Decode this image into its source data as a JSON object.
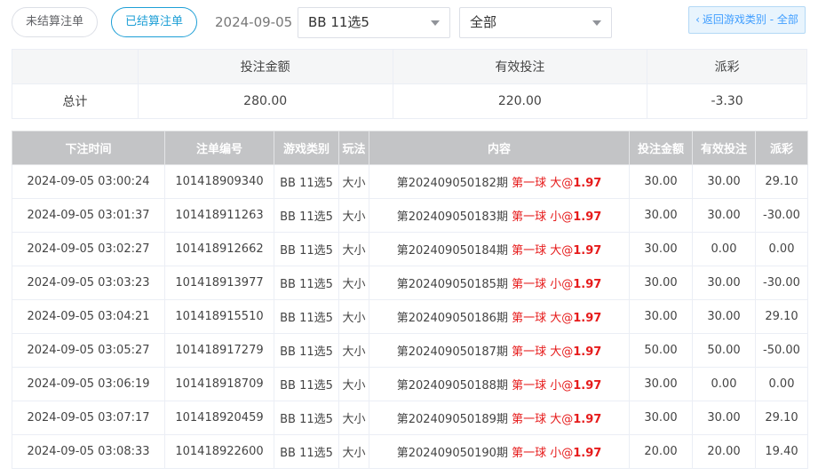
{
  "toolbar": {
    "unsettled_label": "未结算注单",
    "settled_label": "已结算注单",
    "date": "2024-09-05",
    "game_select": "BB 11选5",
    "type_select": "全部",
    "back_label": "返回游戏类别 - 全部"
  },
  "summary": {
    "headers": [
      "投注金额",
      "有效投注",
      "派彩"
    ],
    "row_label": "总计",
    "bet_amount": "280.00",
    "valid_bet": "220.00",
    "payout": "-3.30"
  },
  "detail": {
    "headers": [
      "下注时间",
      "注单编号",
      "游戏类别",
      "玩法",
      "内容",
      "投注金额",
      "有效投注",
      "派彩"
    ],
    "rows": [
      {
        "time": "2024-09-05 03:00:24",
        "id": "101418909340",
        "game": "BB 11选5",
        "play": "大小",
        "period": "第202409050182期",
        "pick": "第一球 大",
        "odds": "1.97",
        "bet": "30.00",
        "valid": "30.00",
        "payout": "29.10",
        "negative": false
      },
      {
        "time": "2024-09-05 03:01:37",
        "id": "101418911263",
        "game": "BB 11选5",
        "play": "大小",
        "period": "第202409050183期",
        "pick": "第一球 小",
        "odds": "1.97",
        "bet": "30.00",
        "valid": "30.00",
        "payout": "-30.00",
        "negative": true
      },
      {
        "time": "2024-09-05 03:02:27",
        "id": "101418912662",
        "game": "BB 11选5",
        "play": "大小",
        "period": "第202409050184期",
        "pick": "第一球 大",
        "odds": "1.97",
        "bet": "30.00",
        "valid": "0.00",
        "payout": "0.00",
        "negative": false
      },
      {
        "time": "2024-09-05 03:03:23",
        "id": "101418913977",
        "game": "BB 11选5",
        "play": "大小",
        "period": "第202409050185期",
        "pick": "第一球 小",
        "odds": "1.97",
        "bet": "30.00",
        "valid": "30.00",
        "payout": "-30.00",
        "negative": true
      },
      {
        "time": "2024-09-05 03:04:21",
        "id": "101418915510",
        "game": "BB 11选5",
        "play": "大小",
        "period": "第202409050186期",
        "pick": "第一球 大",
        "odds": "1.97",
        "bet": "30.00",
        "valid": "30.00",
        "payout": "29.10",
        "negative": false
      },
      {
        "time": "2024-09-05 03:05:27",
        "id": "101418917279",
        "game": "BB 11选5",
        "play": "大小",
        "period": "第202409050187期",
        "pick": "第一球 大",
        "odds": "1.97",
        "bet": "50.00",
        "valid": "50.00",
        "payout": "-50.00",
        "negative": true
      },
      {
        "time": "2024-09-05 03:06:19",
        "id": "101418918709",
        "game": "BB 11选5",
        "play": "大小",
        "period": "第202409050188期",
        "pick": "第一球 小",
        "odds": "1.97",
        "bet": "30.00",
        "valid": "0.00",
        "payout": "0.00",
        "negative": false
      },
      {
        "time": "2024-09-05 03:07:17",
        "id": "101418920459",
        "game": "BB 11选5",
        "play": "大小",
        "period": "第202409050189期",
        "pick": "第一球 大",
        "odds": "1.97",
        "bet": "30.00",
        "valid": "30.00",
        "payout": "29.10",
        "negative": false
      },
      {
        "time": "2024-09-05 03:08:33",
        "id": "101418922600",
        "game": "BB 11选5",
        "play": "大小",
        "period": "第202409050190期",
        "pick": "第一球 小",
        "odds": "1.97",
        "bet": "20.00",
        "valid": "20.00",
        "payout": "19.40",
        "negative": false
      }
    ]
  }
}
